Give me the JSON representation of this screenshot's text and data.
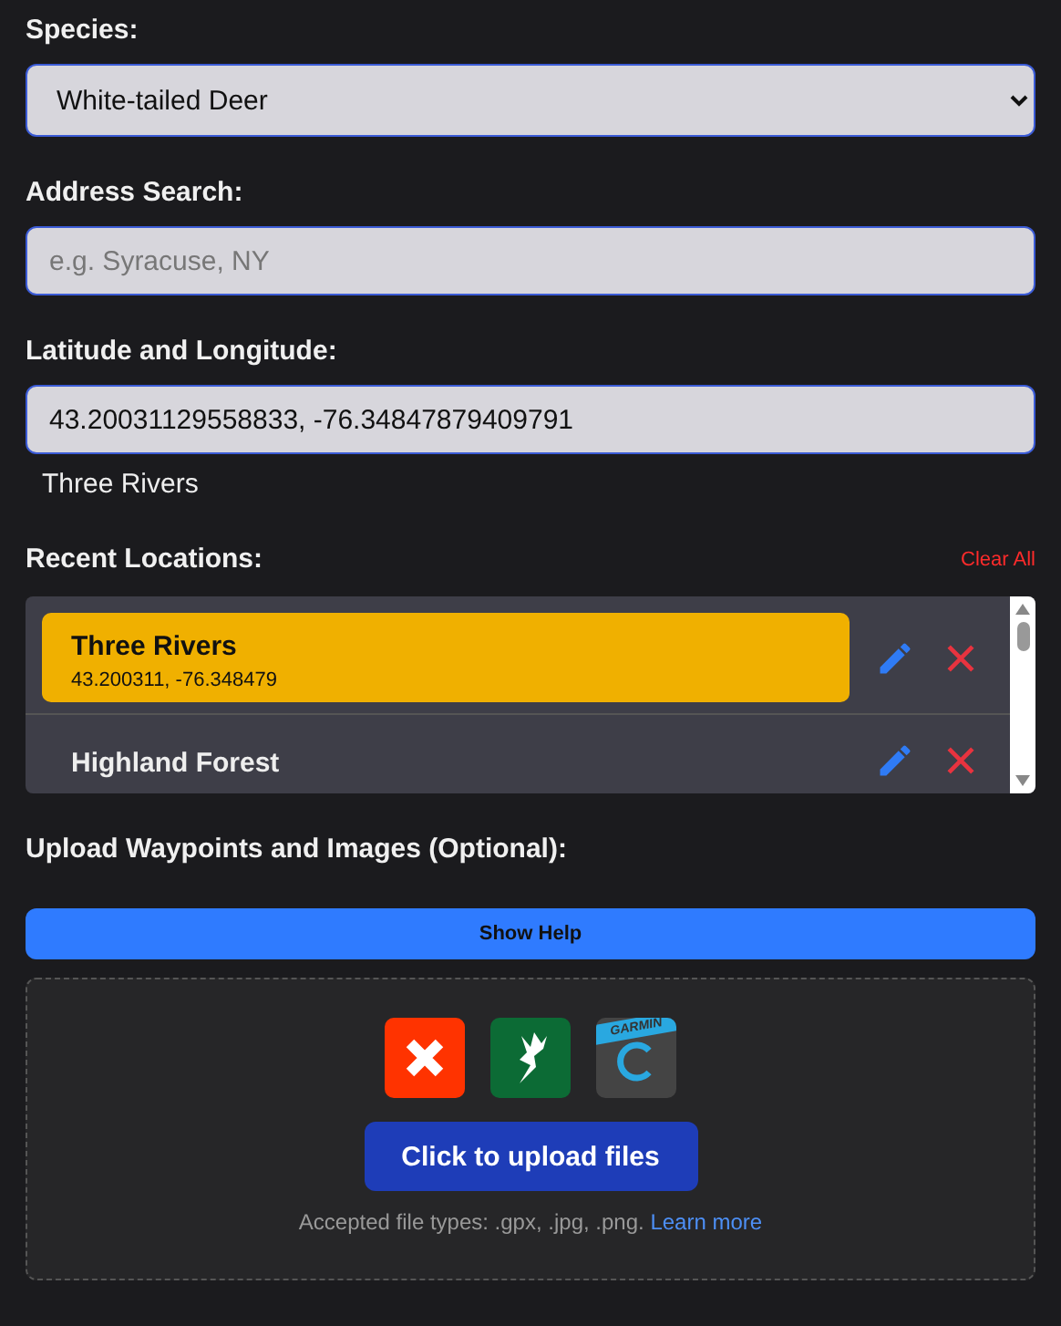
{
  "species": {
    "label": "Species:",
    "value": "White-tailed Deer"
  },
  "address": {
    "label": "Address Search:",
    "placeholder": "e.g. Syracuse, NY"
  },
  "coords": {
    "label": "Latitude and Longitude:",
    "value": "43.20031129558833, -76.34847879409791",
    "place": "Three Rivers"
  },
  "recent": {
    "label": "Recent Locations:",
    "clear": "Clear All",
    "items": [
      {
        "name": "Three Rivers",
        "coords": "43.200311, -76.348479",
        "selected": true
      },
      {
        "name": "Highland Forest",
        "selected": false
      }
    ]
  },
  "upload": {
    "label": "Upload Waypoints and Images (Optional):",
    "help": "Show Help",
    "apps": [
      {
        "kind": "x"
      },
      {
        "kind": "deer"
      },
      {
        "kind": "garmin",
        "text": "GARMIN"
      }
    ],
    "button": "Click to upload files",
    "note": "Accepted file types: .gpx, .jpg, .png.",
    "link": "Learn more"
  }
}
